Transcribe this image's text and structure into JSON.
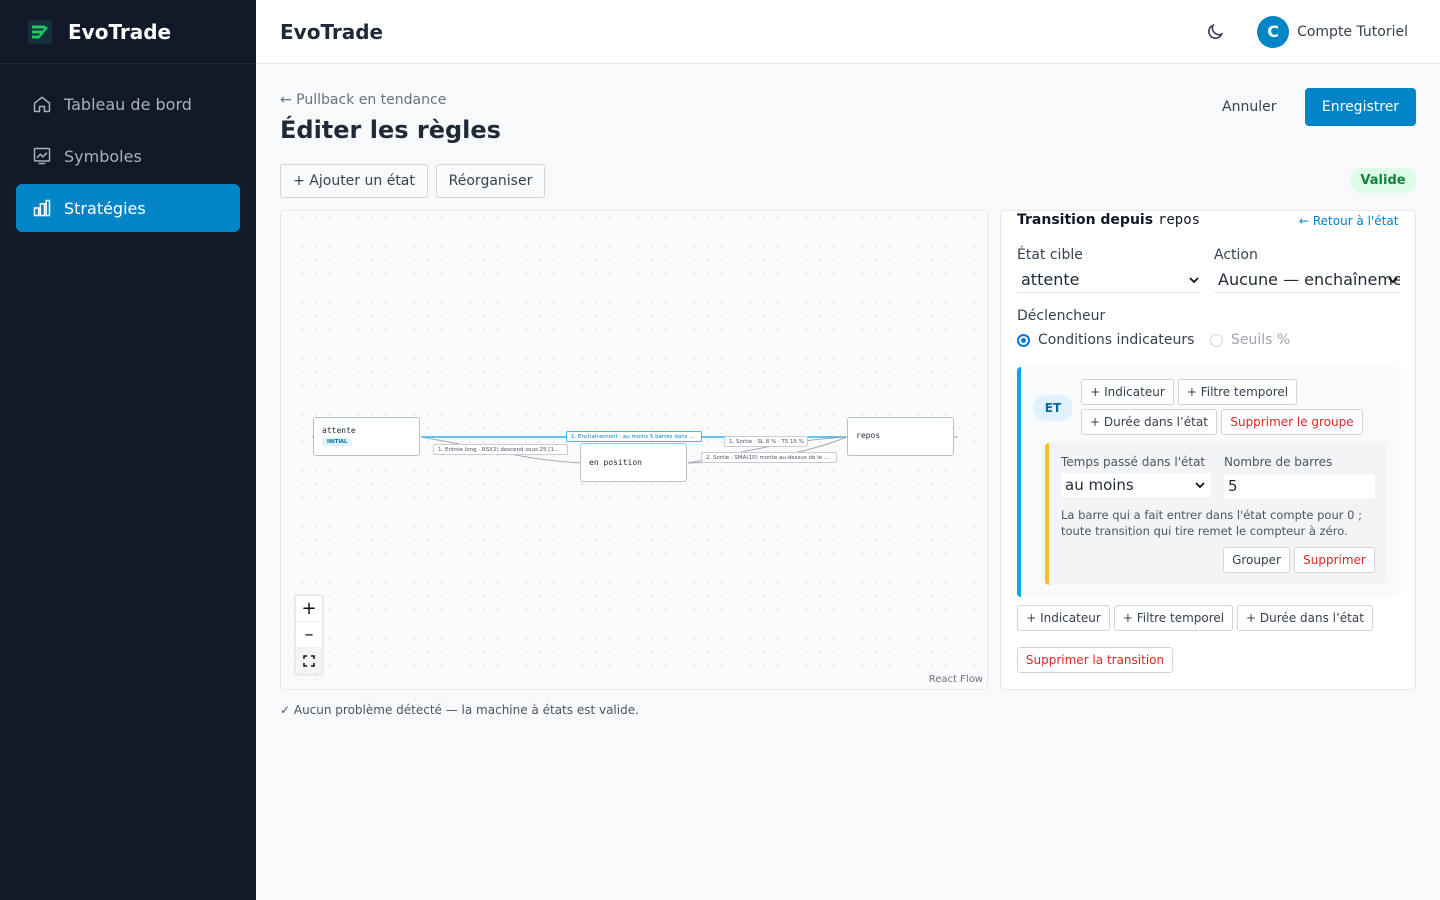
{
  "app": {
    "name": "EvoTrade",
    "brand_color": "#0284c7"
  },
  "sidebar": {
    "items": [
      {
        "label": "Tableau de bord",
        "icon": "home-icon",
        "active": false
      },
      {
        "label": "Symboles",
        "icon": "chart-icon",
        "active": false
      },
      {
        "label": "Stratégies",
        "icon": "bar-chart-icon",
        "active": true
      }
    ]
  },
  "header": {
    "title": "EvoTrade",
    "avatar_letter": "C",
    "user_name": "Compte Tutoriel"
  },
  "page": {
    "back_link": "← Pullback en tendance",
    "title": "Éditer les règles",
    "cancel_label": "Annuler",
    "save_label": "Enregistrer",
    "add_state_label": "+ Ajouter un état",
    "reorganize_label": "Réorganiser",
    "valid_badge": "Valide",
    "status": "✓ Aucun problème détecté — la machine à états est valide."
  },
  "flow": {
    "nodes": [
      {
        "label": "attente",
        "tag": "INITIAL"
      },
      {
        "label": "en position"
      },
      {
        "label": "repos"
      }
    ],
    "edges": [
      "1. Enchaînement · au moins 5 barres dans ...",
      "1. Entrée long · RSI(2) descend sous 25 [1...",
      "1. Sortie · SL 8 % · TS 15 %",
      "2. Sortie · SMA(10) monte au-dessus de le ..."
    ],
    "attribution": "React Flow",
    "zoom_in": "+",
    "zoom_out": "–"
  },
  "panel": {
    "title_prefix": "Transition depuis",
    "title_state": "repos",
    "back_label": "← Retour à l'état",
    "target_label": "État cible",
    "target_value": "attente",
    "action_label": "Action",
    "action_value": "Aucune — enchaînement",
    "trigger_label": "Déclencheur",
    "radio_conditions": "Conditions indicateurs",
    "radio_thresholds": "Seuils %",
    "group": {
      "operator": "ET",
      "add_indicator": "+ Indicateur",
      "add_time_filter": "+ Filtre temporel",
      "add_duration": "+ Durée dans l’état",
      "delete_group": "Supprimer le groupe",
      "condition": {
        "time_label": "Temps passé dans l'état",
        "time_value": "au moins",
        "bars_label": "Nombre de barres",
        "bars_value": "5",
        "hint": "La barre qui a fait entrer dans l'état compte pour 0 ; toute transition qui tire remet le compteur à zéro.",
        "group_btn": "Grouper",
        "delete_btn": "Supprimer"
      }
    },
    "add_indicator": "+ Indicateur",
    "add_time_filter": "+ Filtre temporel",
    "add_duration": "+ Durée dans l’état",
    "delete_transition": "Supprimer la transition"
  }
}
